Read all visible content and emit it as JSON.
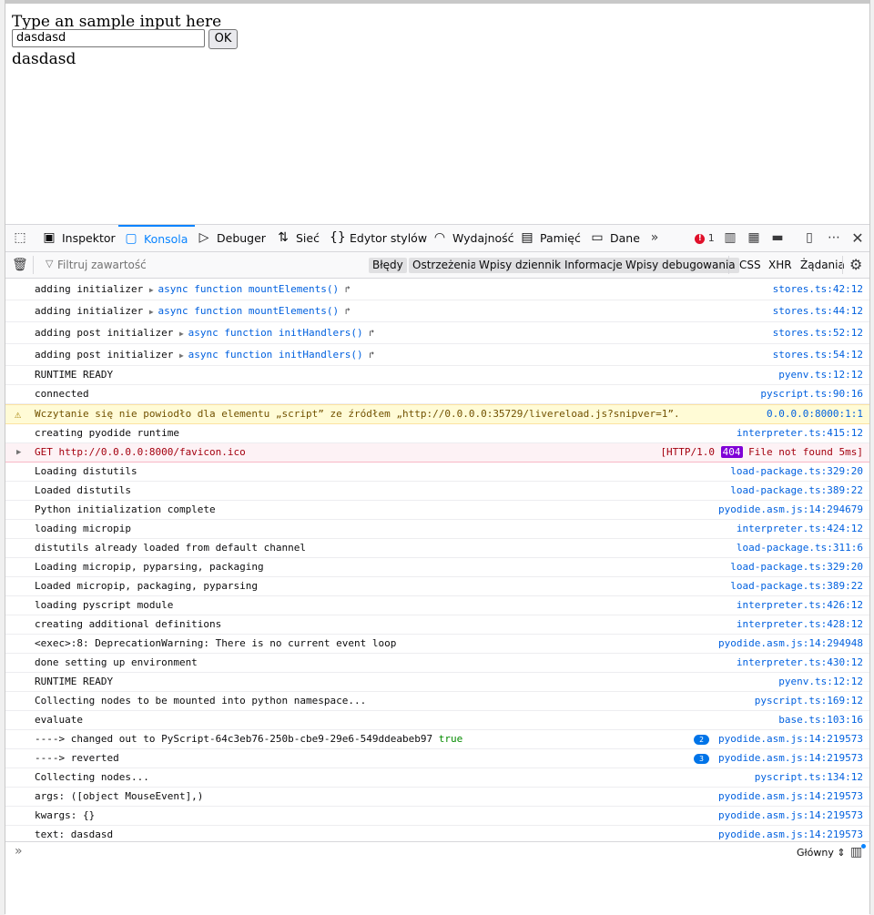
{
  "page": {
    "prompt": "Type an sample input here",
    "input_value": "dasdasd",
    "ok_label": "OK",
    "output": "dasdasd"
  },
  "devtools": {
    "tabs": {
      "inspector": "Inspektor",
      "console": "Konsola",
      "debugger": "Debuger",
      "network": "Sieć",
      "style_editor": "Edytor stylów",
      "performance": "Wydajność",
      "memory": "Pamięć",
      "storage": "Dane"
    },
    "error_count": "1",
    "filter": {
      "placeholder": "Filtruj zawartość",
      "errors": "Błędy",
      "warnings": "Ostrzeżenia",
      "logs": "Wpisy dziennika",
      "info": "Informacje",
      "debug": "Wpisy debugowania",
      "css": "CSS",
      "xhr": "XHR",
      "requests": "Żądania"
    },
    "context_selector": "Główny",
    "log": [
      {
        "text": "adding initializer ",
        "fn": "async function mountElements()",
        "src": "stores.ts:42:12"
      },
      {
        "text": "adding initializer ",
        "fn": "async function mountElements()",
        "src": "stores.ts:44:12"
      },
      {
        "text": "adding post initializer ",
        "fn": "async function initHandlers()",
        "src": "stores.ts:52:12"
      },
      {
        "text": "adding post initializer ",
        "fn": "async function initHandlers()",
        "src": "stores.ts:54:12"
      },
      {
        "text": "RUNTIME READY",
        "src": "pyenv.ts:12:12"
      },
      {
        "text": "connected",
        "src": "pyscript.ts:90:16"
      },
      {
        "text": "Wczytanie się nie powiodło dla elementu „script” ze źródłem „http://0.0.0.0:35729/livereload.js?snipver=1”.",
        "src": "0.0.0.0:8000:1:1"
      },
      {
        "text": "creating pyodide runtime",
        "src": "interpreter.ts:415:12"
      },
      {
        "text": "GET http://0.0.0.0:8000/favicon.ico",
        "src_prefix": "[HTTP/1.0 ",
        "status": "404",
        "src_suffix": " File not found 5ms]"
      },
      {
        "text": "Loading distutils",
        "src": "load-package.ts:329:20"
      },
      {
        "text": "Loaded distutils",
        "src": "load-package.ts:389:22"
      },
      {
        "text": "Python initialization complete",
        "src": "pyodide.asm.js:14:294679"
      },
      {
        "text": "loading micropip",
        "src": "interpreter.ts:424:12"
      },
      {
        "text": "distutils already loaded from default channel",
        "src": "load-package.ts:311:6"
      },
      {
        "text": "Loading micropip, pyparsing, packaging",
        "src": "load-package.ts:329:20"
      },
      {
        "text": "Loaded micropip, packaging, pyparsing",
        "src": "load-package.ts:389:22"
      },
      {
        "text": "loading pyscript module",
        "src": "interpreter.ts:426:12"
      },
      {
        "text": "creating additional definitions",
        "src": "interpreter.ts:428:12"
      },
      {
        "text": "<exec>:8: DeprecationWarning: There is no current event loop",
        "src": "pyodide.asm.js:14:294948"
      },
      {
        "text": "done setting up environment",
        "src": "interpreter.ts:430:12"
      },
      {
        "text": "RUNTIME READY",
        "src": "pyenv.ts:12:12"
      },
      {
        "text": "Collecting nodes to be mounted into python namespace...",
        "src": "pyscript.ts:169:12"
      },
      {
        "text": "evaluate",
        "src": "base.ts:103:16"
      },
      {
        "text": "----> changed out to PyScript-64c3eb76-250b-cbe9-29e6-549ddeabeb97 ",
        "value": "true",
        "count": "2",
        "src": "pyodide.asm.js:14:219573"
      },
      {
        "text": "----> reverted",
        "count": "3",
        "src": "pyodide.asm.js:14:219573"
      },
      {
        "text": "Collecting nodes...",
        "src": "pyscript.ts:134:12"
      },
      {
        "text": "args: ([object MouseEvent],)",
        "src": "pyodide.asm.js:14:219573"
      },
      {
        "text": "kwargs: {}",
        "src": "pyodide.asm.js:14:219573"
      },
      {
        "text": "text: dasdasd",
        "src": "pyodide.asm.js:14:219573"
      }
    ]
  }
}
